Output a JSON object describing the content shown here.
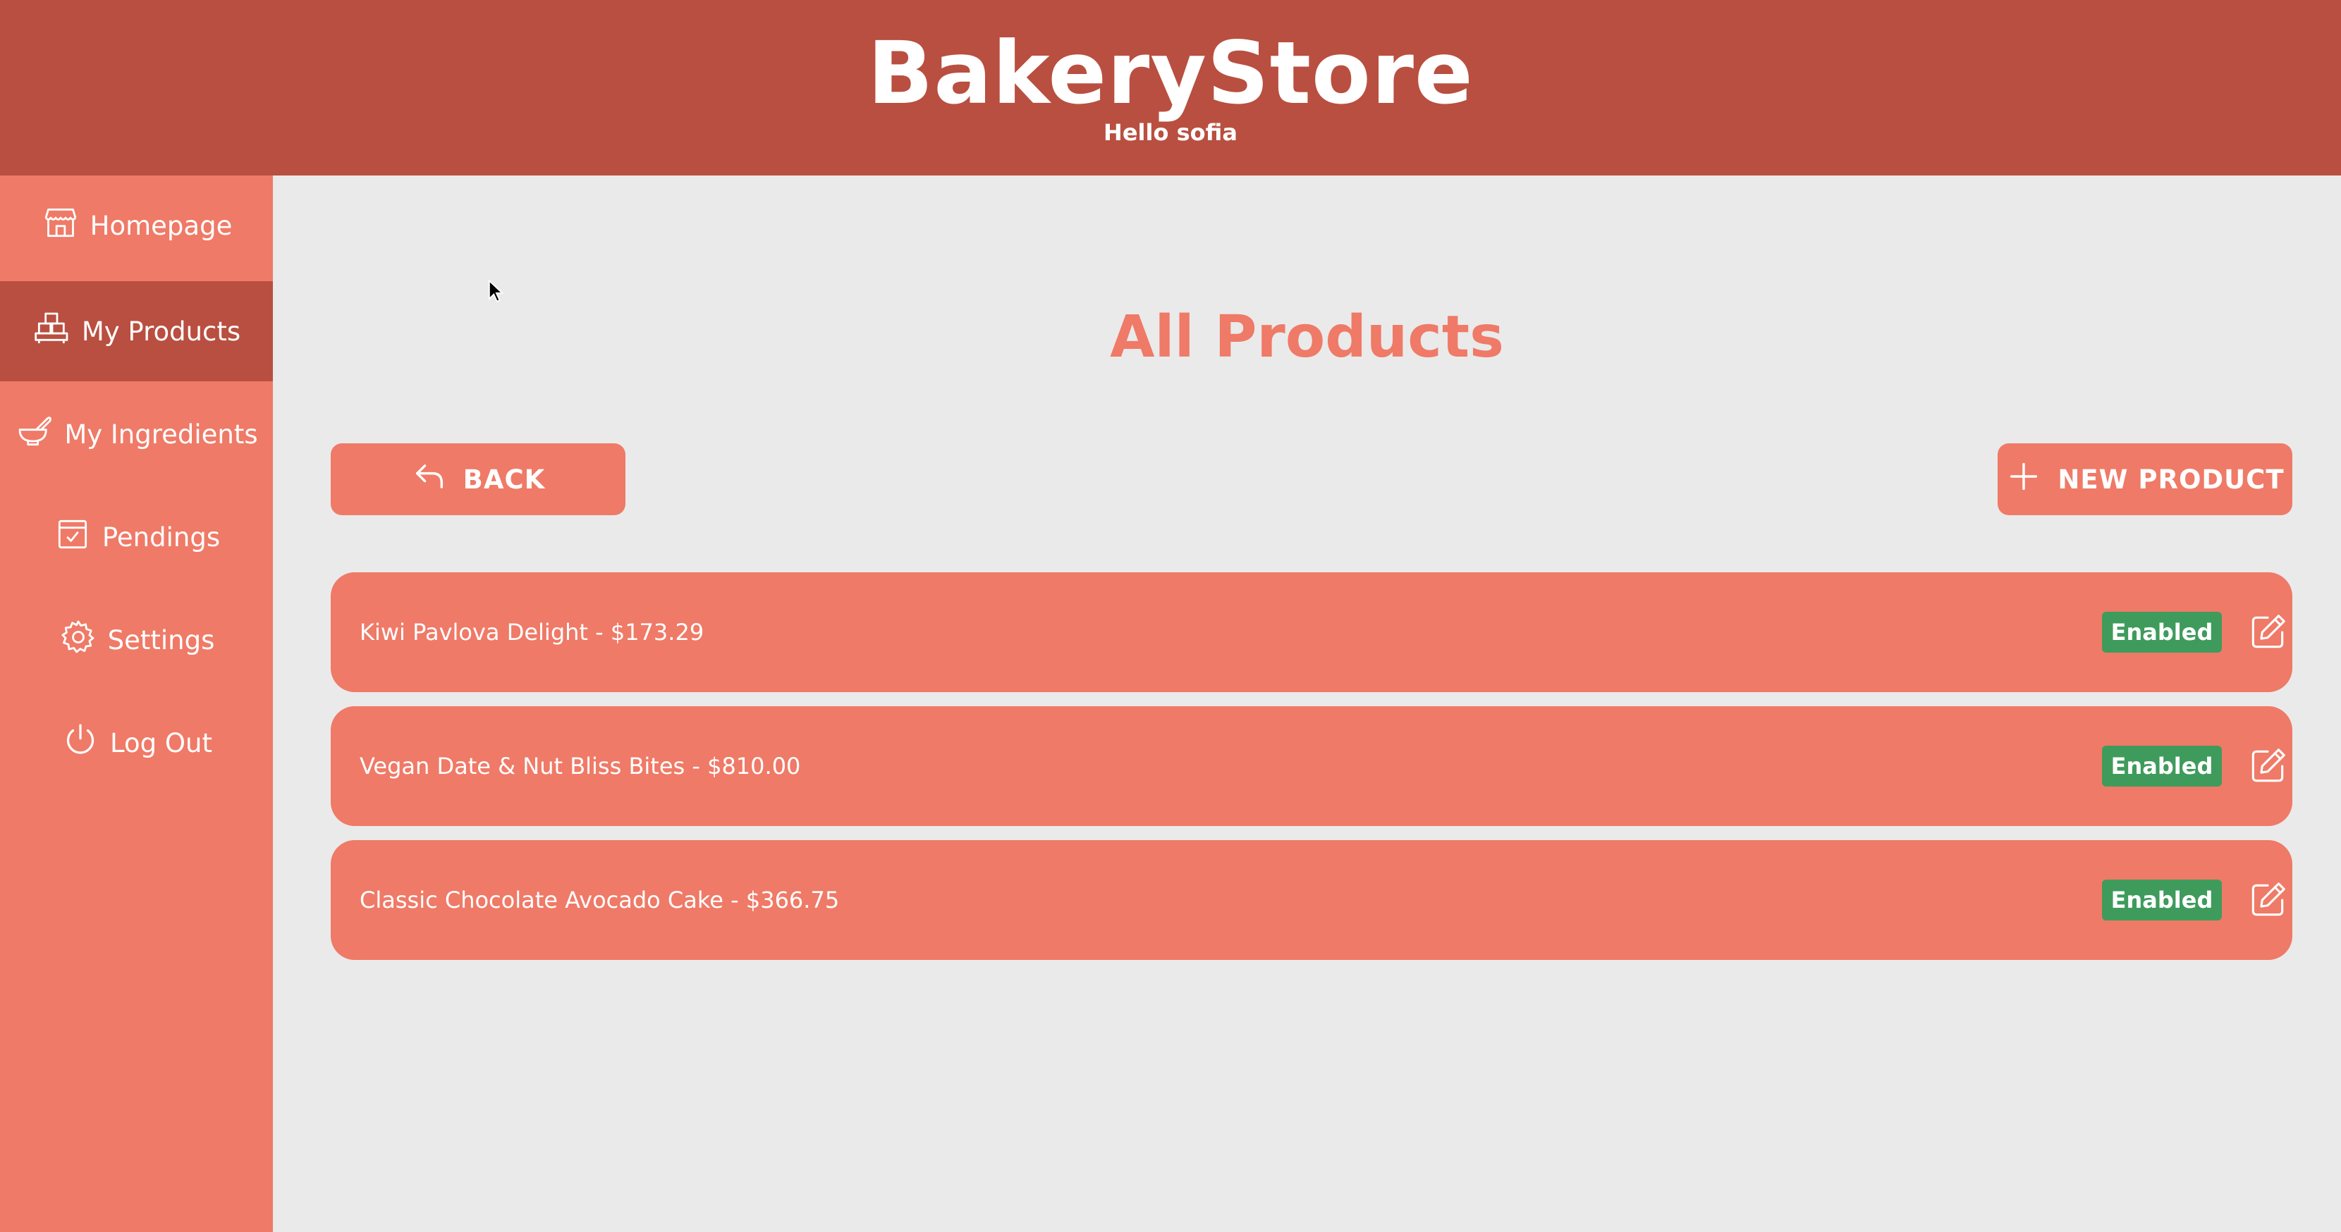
{
  "header": {
    "brand": "BakeryStore",
    "greeting": "Hello sofia"
  },
  "sidebar": {
    "items": [
      {
        "label": "Homepage",
        "icon": "store-icon",
        "active": false
      },
      {
        "label": "My Products",
        "icon": "products-icon",
        "active": true
      },
      {
        "label": "My Ingredients",
        "icon": "bowl-icon",
        "active": false
      },
      {
        "label": "Pendings",
        "icon": "checkbox-icon",
        "active": false
      },
      {
        "label": "Settings",
        "icon": "gear-icon",
        "active": false
      },
      {
        "label": "Log Out",
        "icon": "power-icon",
        "active": false
      }
    ]
  },
  "main": {
    "title": "All Products",
    "back_label": "BACK",
    "new_product_label": "NEW PRODUCT",
    "products": [
      {
        "text": "Kiwi Pavlova Delight - $173.29",
        "status": "Enabled"
      },
      {
        "text": "Vegan Date & Nut Bliss Bites - $810.00",
        "status": "Enabled"
      },
      {
        "text": "Classic Chocolate Avocado Cake - $366.75",
        "status": "Enabled"
      }
    ]
  },
  "colors": {
    "header_bg": "#b94f40",
    "sidebar_bg": "#ef7a67",
    "sidebar_active_bg": "#b94f40",
    "accent": "#ef7a67",
    "status_enabled": "#3f9b5c",
    "page_bg": "#eaeaea"
  }
}
